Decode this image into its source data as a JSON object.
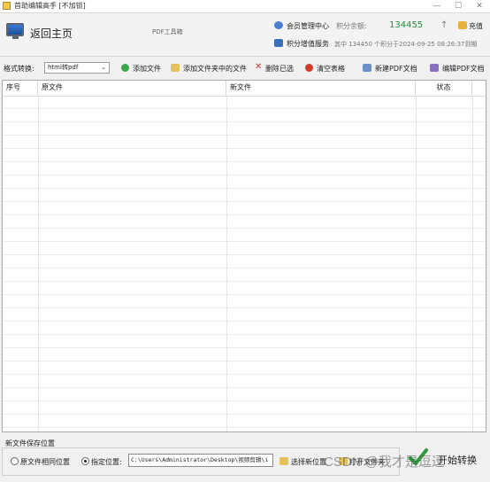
{
  "window": {
    "title": "首助编辑高手 [不加锁]",
    "minimize": "—",
    "maximize": "☐",
    "close": "✕"
  },
  "header": {
    "home_label": "返回主页",
    "tool_label": "PDF工具箱",
    "member_center": "会员管理中心",
    "points_label": "积分余额:",
    "points_value": "134455",
    "up_arrow": "↑",
    "recharge": "充值",
    "points_service": "积分增值服务",
    "points_note": "其中 134450 个积分于2024-09-25 08:26:37到期"
  },
  "toolbar": {
    "format_label": "格式转换:",
    "format_value": "html转pdf",
    "add_file": "添加文件",
    "add_folder": "添加文件夹中的文件",
    "delete_selected": "删除已选",
    "clear_table": "清空表格",
    "new_pdf": "新建PDF文档",
    "edit_pdf": "编辑PDF文档",
    "colors": {
      "add": "#3aa84a",
      "delete": "#d23a2a",
      "clear": "#d23a2a"
    }
  },
  "table": {
    "columns": [
      "序号",
      "原文件",
      "新文件",
      "状态"
    ],
    "rows": []
  },
  "footer": {
    "section_title": "新文件保存位置",
    "option_same": "原文件相同位置",
    "option_custom": "指定位置:",
    "selected_option": "指定位置:",
    "path_value": "C:\\Users\\Administrator\\Desktop\\视频剪辑\\i",
    "choose_location": "选择新位置",
    "open_folder": "打开文件夹",
    "start_convert": "开始转换"
  },
  "watermark": "CSDN @我才是逗逗"
}
